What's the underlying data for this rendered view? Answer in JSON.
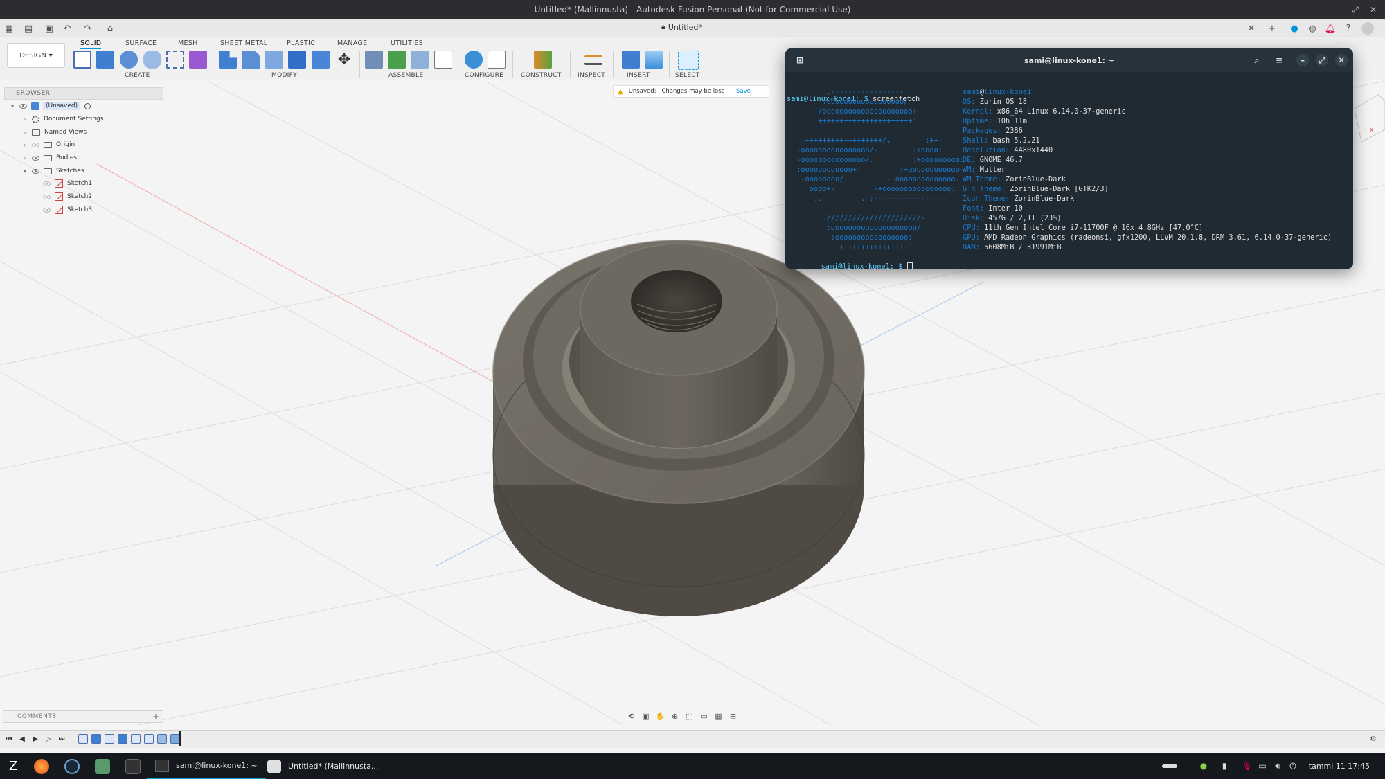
{
  "window": {
    "title": "Untitled* (Mallinnusta) - Autodesk Fusion Personal (Not for Commercial Use)",
    "doc_tab": "Untitled*"
  },
  "ribbon": {
    "workspace": "DESIGN",
    "tabs": [
      "SOLID",
      "SURFACE",
      "MESH",
      "SHEET METAL",
      "PLASTIC",
      "MANAGE",
      "UTILITIES"
    ],
    "active_tab": "SOLID",
    "groups": [
      "CREATE",
      "MODIFY",
      "ASSEMBLE",
      "CONFIGURE",
      "CONSTRUCT",
      "INSPECT",
      "INSERT",
      "SELECT"
    ]
  },
  "browser": {
    "title": "BROWSER",
    "root": "(Unsaved)",
    "items": [
      {
        "label": "Document Settings"
      },
      {
        "label": "Named Views"
      },
      {
        "label": "Origin"
      },
      {
        "label": "Bodies"
      },
      {
        "label": "Sketches"
      },
      {
        "label": "Sketch1"
      },
      {
        "label": "Sketch2"
      },
      {
        "label": "Sketch3"
      }
    ]
  },
  "notice": {
    "label": "Unsaved:",
    "message": "Changes may be lost",
    "action": "Save"
  },
  "terminal": {
    "title": "sami@linux-kone1: ~",
    "prompt": "sami@linux-kone1: $",
    "command": "screenfetch",
    "logo": "        .-----------------.\n       :oooooooooooooooooo/\n      /ooooooooooooooooooooo+\n     :++++++++++++++++++++++:\n\n  .++++++++++++++++++/.        :++-\n -oooooooooooooooo/-        -+oooo:\n -ooooooooooooooo/.         :+ooooooooo:\n :oooooooooooo+-         :+oooooooooooo-\n  -oooooooo/.         -+oooooooooooooo.\n   .oooo+-         -+oooooooooooooooo.\n     ..-        .-:-----------------\n\n       .//////////////////////-\n        :oooooooooooooooooooo/\n         :ooooooooooooooooo:\n          `++++++++++++++++`",
    "info": [
      {
        "key": "",
        "value": "sami@linux-kone1",
        "split_user": true
      },
      {
        "key": "OS:",
        "value": "Zorin OS 18"
      },
      {
        "key": "Kernel:",
        "value": "x86_64 Linux 6.14.0-37-generic"
      },
      {
        "key": "Uptime:",
        "value": "10h 11m"
      },
      {
        "key": "Packages:",
        "value": "2386"
      },
      {
        "key": "Shell:",
        "value": "bash 5.2.21"
      },
      {
        "key": "Resolution:",
        "value": "4480x1440"
      },
      {
        "key": "DE:",
        "value": "GNOME 46.7"
      },
      {
        "key": "WM:",
        "value": "Mutter"
      },
      {
        "key": "WM Theme:",
        "value": "ZorinBlue-Dark"
      },
      {
        "key": "GTK Theme:",
        "value": "ZorinBlue-Dark [GTK2/3]"
      },
      {
        "key": "Icon Theme:",
        "value": "ZorinBlue-Dark"
      },
      {
        "key": "Font:",
        "value": "Inter 10"
      },
      {
        "key": "Disk:",
        "value": "457G / 2,1T (23%)"
      },
      {
        "key": "CPU:",
        "value": "11th Gen Intel Core i7-11700F @ 16x 4.8GHz [47.0°C]"
      },
      {
        "key": "GPU:",
        "value": "AMD Radeon Graphics (radeonsi, gfx1200, LLVM 20.1.8, DRM 3.61, 6.14.0-37-generic)"
      },
      {
        "key": "RAM:",
        "value": "5608MiB / 31991MiB"
      }
    ]
  },
  "comments": {
    "label": "COMMENTS"
  },
  "taskbar": {
    "apps": [
      {
        "label": "sami@linux-kone1: ~"
      },
      {
        "label": "Untitled* (Mallinnusta..."
      }
    ],
    "clock": "tammi 11  17:45"
  },
  "colors": {
    "accent": "#0696d7",
    "terminal_bg": "#1f2a33",
    "logo_blue": "#1b78c9",
    "taskbar_bg": "#15191d"
  }
}
